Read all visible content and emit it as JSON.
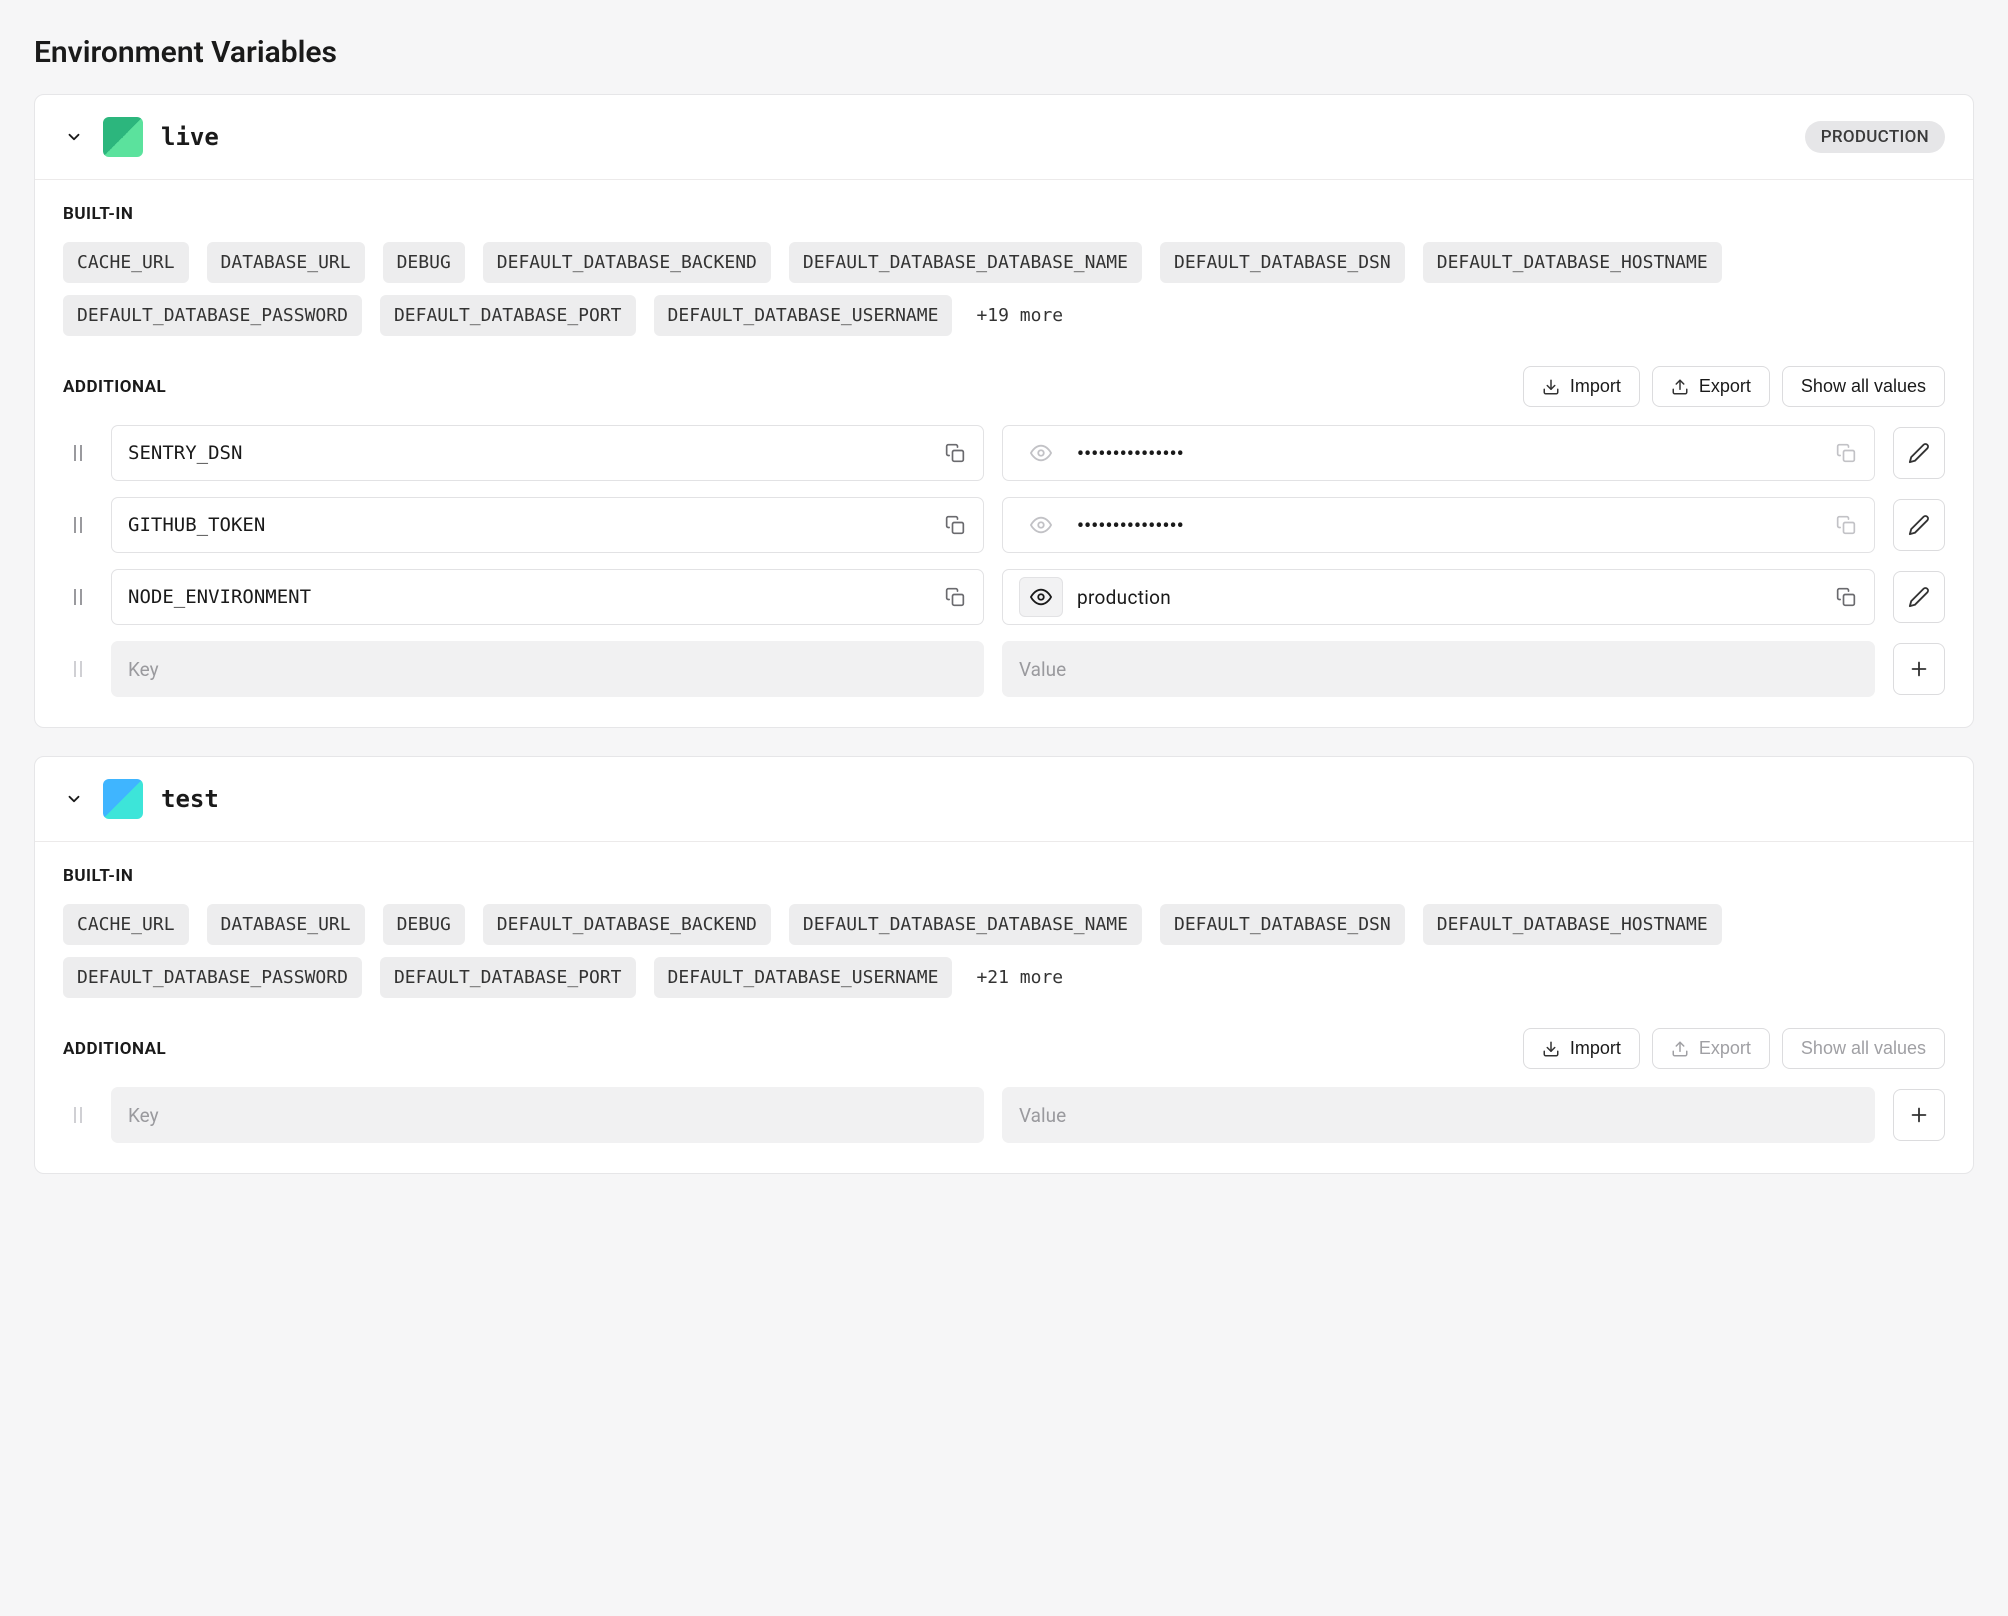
{
  "page_title": "Environment Variables",
  "sections": {
    "builtin_label": "BUILT-IN",
    "additional_label": "ADDITIONAL"
  },
  "buttons": {
    "import": "Import",
    "export": "Export",
    "show_all": "Show all values"
  },
  "placeholders": {
    "key": "Key",
    "value": "Value"
  },
  "masked_value": "•••••••••••••••",
  "environments": [
    {
      "name": "live",
      "icon": "green",
      "badge": "PRODUCTION",
      "builtin": [
        "CACHE_URL",
        "DATABASE_URL",
        "DEBUG",
        "DEFAULT_DATABASE_BACKEND",
        "DEFAULT_DATABASE_DATABASE_NAME",
        "DEFAULT_DATABASE_DSN",
        "DEFAULT_DATABASE_HOSTNAME",
        "DEFAULT_DATABASE_PASSWORD",
        "DEFAULT_DATABASE_PORT",
        "DEFAULT_DATABASE_USERNAME"
      ],
      "builtin_more": "+19 more",
      "export_enabled": true,
      "show_all_enabled": true,
      "additional": [
        {
          "key": "SENTRY_DSN",
          "value": null,
          "revealed": false
        },
        {
          "key": "GITHUB_TOKEN",
          "value": null,
          "revealed": false
        },
        {
          "key": "NODE_ENVIRONMENT",
          "value": "production",
          "revealed": true
        }
      ]
    },
    {
      "name": "test",
      "icon": "blue",
      "badge": null,
      "builtin": [
        "CACHE_URL",
        "DATABASE_URL",
        "DEBUG",
        "DEFAULT_DATABASE_BACKEND",
        "DEFAULT_DATABASE_DATABASE_NAME",
        "DEFAULT_DATABASE_DSN",
        "DEFAULT_DATABASE_HOSTNAME",
        "DEFAULT_DATABASE_PASSWORD",
        "DEFAULT_DATABASE_PORT",
        "DEFAULT_DATABASE_USERNAME"
      ],
      "builtin_more": "+21 more",
      "export_enabled": false,
      "show_all_enabled": false,
      "additional": []
    }
  ]
}
